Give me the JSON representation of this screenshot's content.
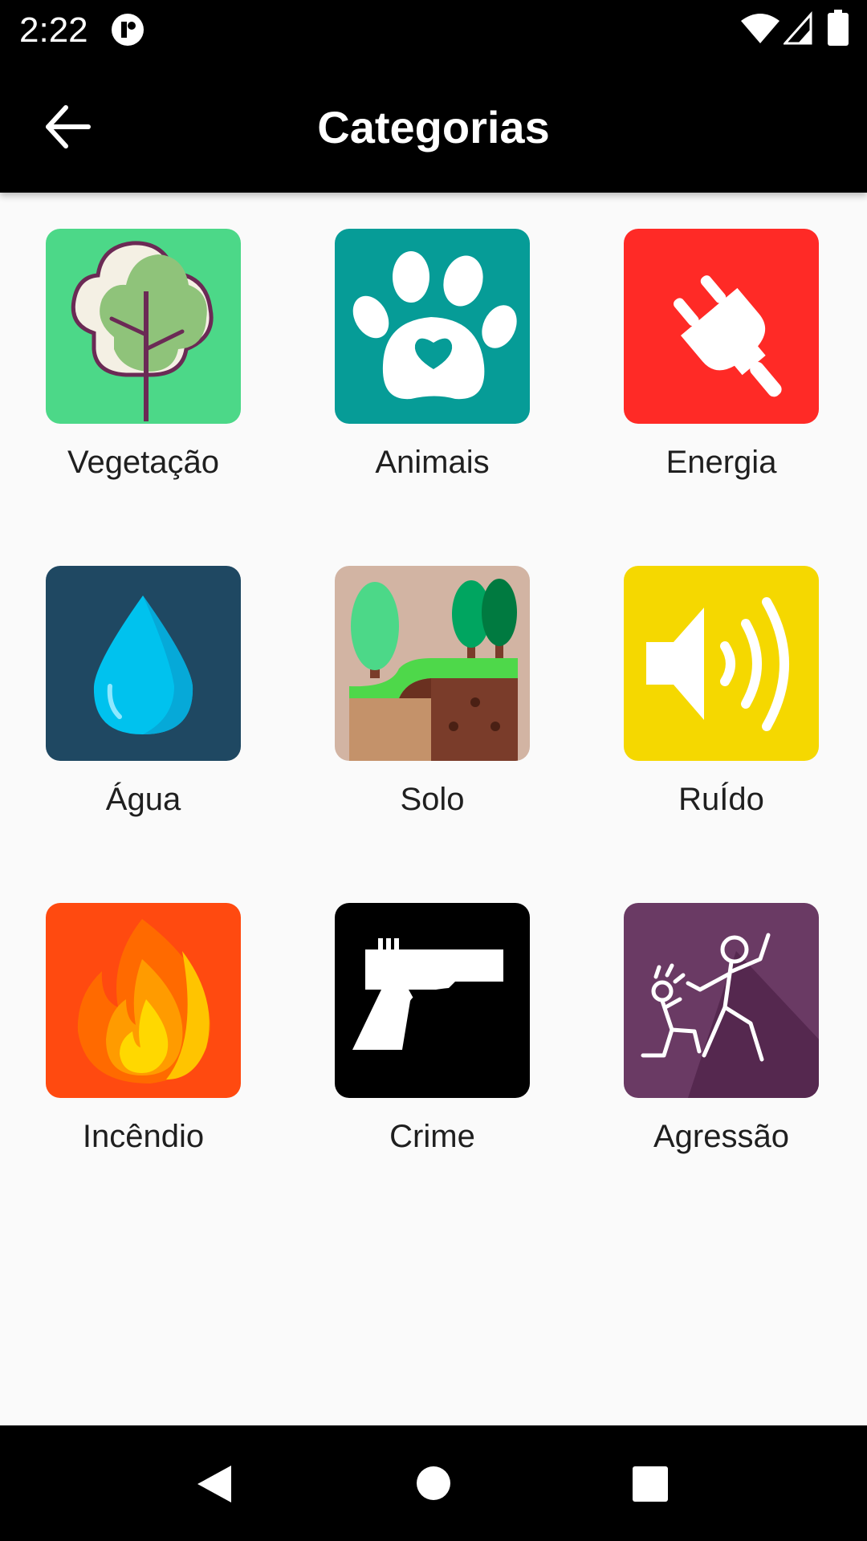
{
  "status_bar": {
    "time": "2:22",
    "icons": [
      "app-notification-icon",
      "wifi-icon",
      "signal-icon",
      "battery-icon"
    ]
  },
  "app_bar": {
    "title": "Categorias",
    "back_icon": "arrow-back-icon"
  },
  "categories": [
    {
      "label": "Vegetação",
      "icon": "tree-icon",
      "color": "#4cd888"
    },
    {
      "label": "Animais",
      "icon": "paw-icon",
      "color": "#069c97"
    },
    {
      "label": "Energia",
      "icon": "plug-icon",
      "color": "#ff2a26"
    },
    {
      "label": "Água",
      "icon": "water-drop-icon",
      "color": "#1f4862"
    },
    {
      "label": "Solo",
      "icon": "soil-icon",
      "color": "#d2b4a3"
    },
    {
      "label": "RuÍdo",
      "icon": "speaker-icon",
      "color": "#f5d800"
    },
    {
      "label": "Incêndio",
      "icon": "fire-icon",
      "color": "#ff4a10"
    },
    {
      "label": "Crime",
      "icon": "gun-icon",
      "color": "#000000"
    },
    {
      "label": "Agressão",
      "icon": "aggression-icon",
      "color": "#6a3a64"
    }
  ],
  "nav_bar": {
    "icons": [
      "nav-back-icon",
      "nav-home-icon",
      "nav-recents-icon"
    ]
  }
}
